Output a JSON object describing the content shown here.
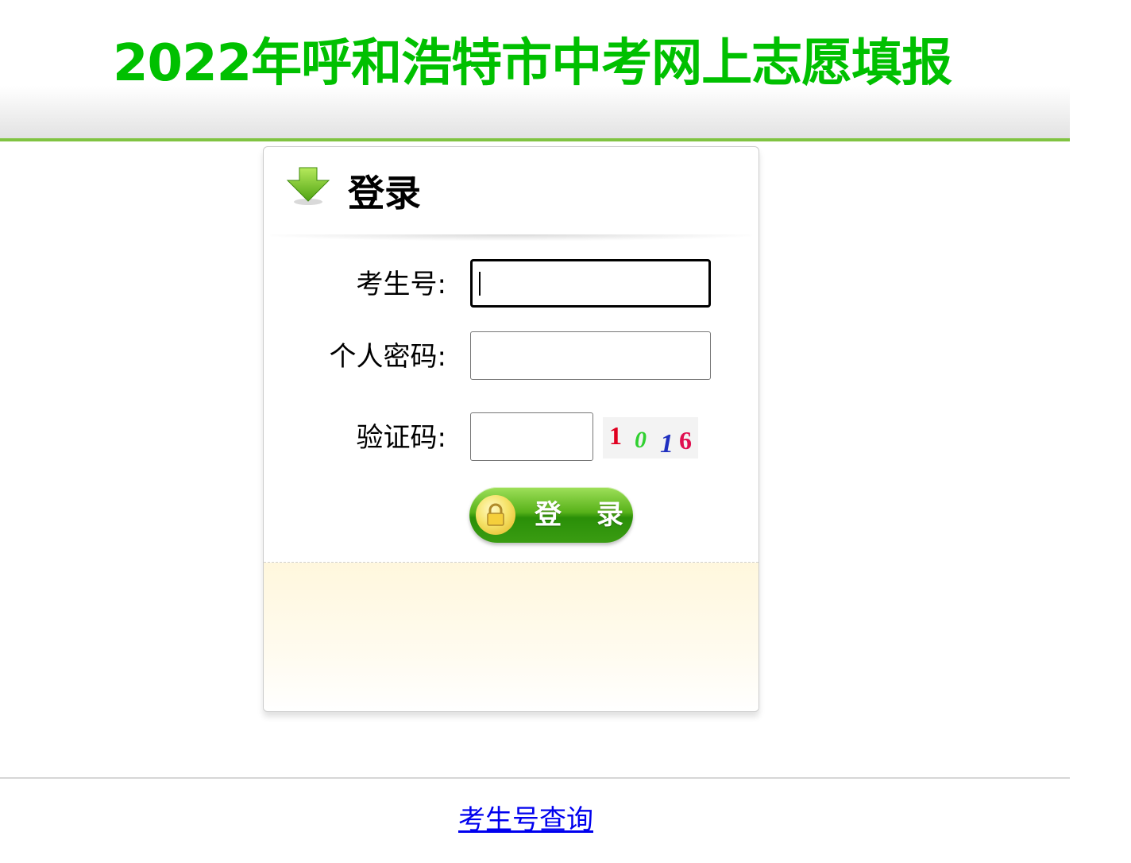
{
  "header": {
    "title": "2022年呼和浩特市中考网上志愿填报"
  },
  "login_panel": {
    "title": "登录",
    "fields": {
      "exam_number": {
        "label": "考生号:",
        "value": "",
        "placeholder": ""
      },
      "password": {
        "label": "个人密码:",
        "value": "",
        "placeholder": ""
      },
      "captcha": {
        "label": "验证码:",
        "value": "",
        "placeholder": "",
        "image_text": [
          "1",
          "0",
          "1",
          "6"
        ]
      }
    },
    "submit_label": "登 录"
  },
  "footer": {
    "link_label": "考生号查询"
  },
  "colors": {
    "title_green": "#00c000",
    "header_line": "#80c341",
    "link_blue": "#0000ee"
  }
}
